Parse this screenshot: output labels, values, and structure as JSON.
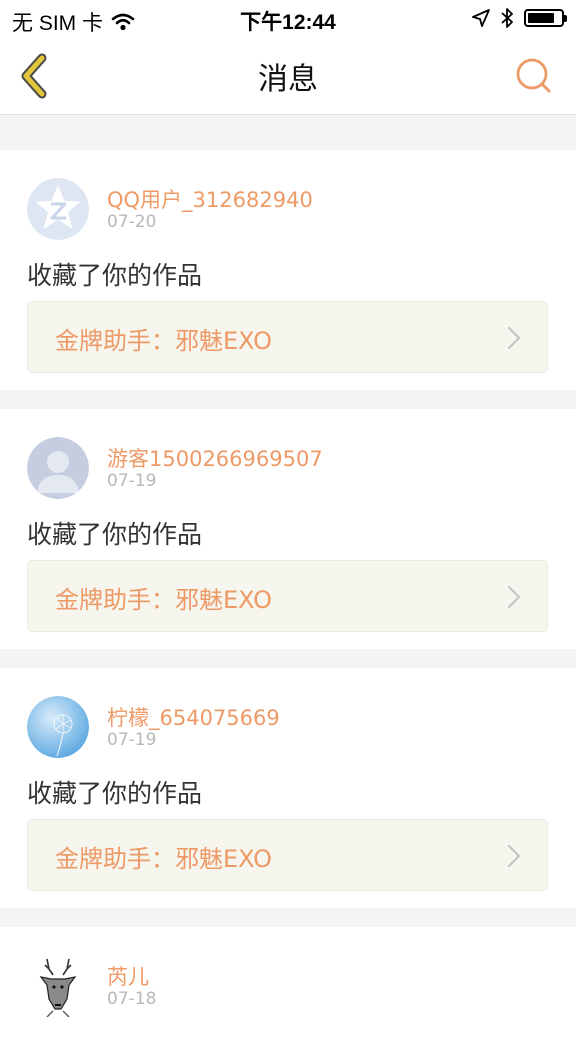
{
  "status_bar": {
    "carrier": "无 SIM 卡",
    "time": "下午12:44",
    "battery_level": 0.8
  },
  "nav": {
    "title": "消息"
  },
  "messages": [
    {
      "username": "QQ用户_312682940",
      "date": "07-20",
      "action": "收藏了你的作品",
      "work": "金牌助手：邪魅EXO",
      "avatar": "qq-star-avatar"
    },
    {
      "username": "游客1500266969507",
      "date": "07-19",
      "action": "收藏了你的作品",
      "work": "金牌助手：邪魅EXO",
      "avatar": "default-person-avatar"
    },
    {
      "username": "柠檬_654075669",
      "date": "07-19",
      "action": "收藏了你的作品",
      "work": "金牌助手：邪魅EXO",
      "avatar": "sky-dandelion-avatar"
    },
    {
      "username": "芮儿",
      "date": "07-18",
      "action": "",
      "work": "",
      "avatar": "deer-sketch-avatar"
    }
  ],
  "colors": {
    "accent": "#ee9a66",
    "back_arrow": "#e2c63b",
    "work_box_bg": "#f6f5ee"
  }
}
